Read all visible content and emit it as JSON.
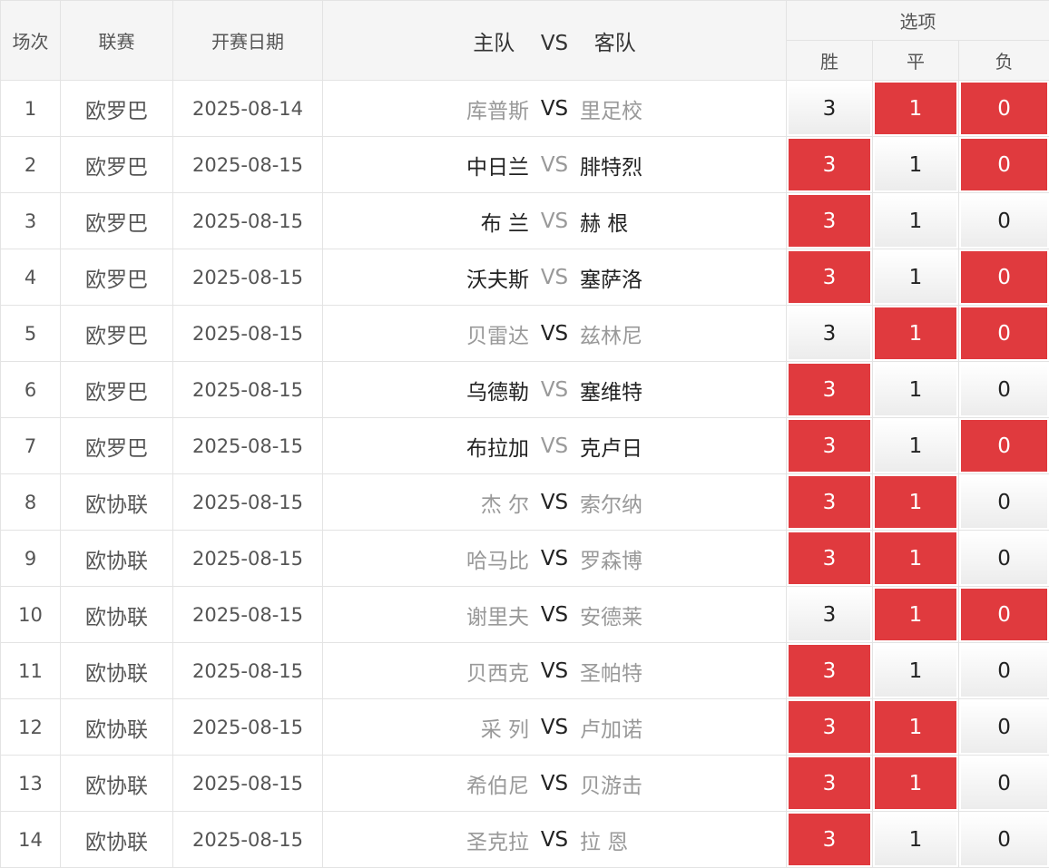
{
  "header": {
    "index": "场次",
    "league": "联赛",
    "date": "开赛日期",
    "home": "主队",
    "vs": "VS",
    "away": "客队",
    "options": "选项",
    "win": "胜",
    "draw": "平",
    "lose": "负"
  },
  "colors": {
    "selected_bg": "#e03a3e",
    "selected_text": "#ffffff",
    "muted_text": "#999999"
  },
  "rows": [
    {
      "index": "1",
      "league": "欧罗巴",
      "date": "2025-08-14",
      "home": "库普斯",
      "away": "里足校",
      "home_muted": true,
      "vs_muted": false,
      "away_muted": true,
      "win": "3",
      "draw": "1",
      "lose": "0",
      "win_selected": false,
      "draw_selected": true,
      "lose_selected": true
    },
    {
      "index": "2",
      "league": "欧罗巴",
      "date": "2025-08-15",
      "home": "中日兰",
      "away": "腓特烈",
      "home_muted": false,
      "vs_muted": true,
      "away_muted": false,
      "win": "3",
      "draw": "1",
      "lose": "0",
      "win_selected": true,
      "draw_selected": false,
      "lose_selected": true
    },
    {
      "index": "3",
      "league": "欧罗巴",
      "date": "2025-08-15",
      "home": "布 兰",
      "away": "赫 根",
      "home_muted": false,
      "vs_muted": true,
      "away_muted": false,
      "win": "3",
      "draw": "1",
      "lose": "0",
      "win_selected": true,
      "draw_selected": false,
      "lose_selected": false
    },
    {
      "index": "4",
      "league": "欧罗巴",
      "date": "2025-08-15",
      "home": "沃夫斯",
      "away": "塞萨洛",
      "home_muted": false,
      "vs_muted": true,
      "away_muted": false,
      "win": "3",
      "draw": "1",
      "lose": "0",
      "win_selected": true,
      "draw_selected": false,
      "lose_selected": true
    },
    {
      "index": "5",
      "league": "欧罗巴",
      "date": "2025-08-15",
      "home": "贝雷达",
      "away": "兹林尼",
      "home_muted": true,
      "vs_muted": false,
      "away_muted": true,
      "win": "3",
      "draw": "1",
      "lose": "0",
      "win_selected": false,
      "draw_selected": true,
      "lose_selected": true
    },
    {
      "index": "6",
      "league": "欧罗巴",
      "date": "2025-08-15",
      "home": "乌德勒",
      "away": "塞维特",
      "home_muted": false,
      "vs_muted": true,
      "away_muted": false,
      "win": "3",
      "draw": "1",
      "lose": "0",
      "win_selected": true,
      "draw_selected": false,
      "lose_selected": false
    },
    {
      "index": "7",
      "league": "欧罗巴",
      "date": "2025-08-15",
      "home": "布拉加",
      "away": "克卢日",
      "home_muted": false,
      "vs_muted": true,
      "away_muted": false,
      "win": "3",
      "draw": "1",
      "lose": "0",
      "win_selected": true,
      "draw_selected": false,
      "lose_selected": true
    },
    {
      "index": "8",
      "league": "欧协联",
      "date": "2025-08-15",
      "home": "杰 尔",
      "away": "索尔纳",
      "home_muted": true,
      "vs_muted": false,
      "away_muted": true,
      "win": "3",
      "draw": "1",
      "lose": "0",
      "win_selected": true,
      "draw_selected": true,
      "lose_selected": false
    },
    {
      "index": "9",
      "league": "欧协联",
      "date": "2025-08-15",
      "home": "哈马比",
      "away": "罗森博",
      "home_muted": true,
      "vs_muted": false,
      "away_muted": true,
      "win": "3",
      "draw": "1",
      "lose": "0",
      "win_selected": true,
      "draw_selected": true,
      "lose_selected": false
    },
    {
      "index": "10",
      "league": "欧协联",
      "date": "2025-08-15",
      "home": "谢里夫",
      "away": "安德莱",
      "home_muted": true,
      "vs_muted": false,
      "away_muted": true,
      "win": "3",
      "draw": "1",
      "lose": "0",
      "win_selected": false,
      "draw_selected": true,
      "lose_selected": true
    },
    {
      "index": "11",
      "league": "欧协联",
      "date": "2025-08-15",
      "home": "贝西克",
      "away": "圣帕特",
      "home_muted": true,
      "vs_muted": false,
      "away_muted": true,
      "win": "3",
      "draw": "1",
      "lose": "0",
      "win_selected": true,
      "draw_selected": false,
      "lose_selected": false
    },
    {
      "index": "12",
      "league": "欧协联",
      "date": "2025-08-15",
      "home": "采 列",
      "away": "卢加诺",
      "home_muted": true,
      "vs_muted": false,
      "away_muted": true,
      "win": "3",
      "draw": "1",
      "lose": "0",
      "win_selected": true,
      "draw_selected": true,
      "lose_selected": false
    },
    {
      "index": "13",
      "league": "欧协联",
      "date": "2025-08-15",
      "home": "希伯尼",
      "away": "贝游击",
      "home_muted": true,
      "vs_muted": false,
      "away_muted": true,
      "win": "3",
      "draw": "1",
      "lose": "0",
      "win_selected": true,
      "draw_selected": true,
      "lose_selected": false
    },
    {
      "index": "14",
      "league": "欧协联",
      "date": "2025-08-15",
      "home": "圣克拉",
      "away": "拉 恩",
      "home_muted": true,
      "vs_muted": false,
      "away_muted": true,
      "win": "3",
      "draw": "1",
      "lose": "0",
      "win_selected": true,
      "draw_selected": false,
      "lose_selected": false
    }
  ]
}
